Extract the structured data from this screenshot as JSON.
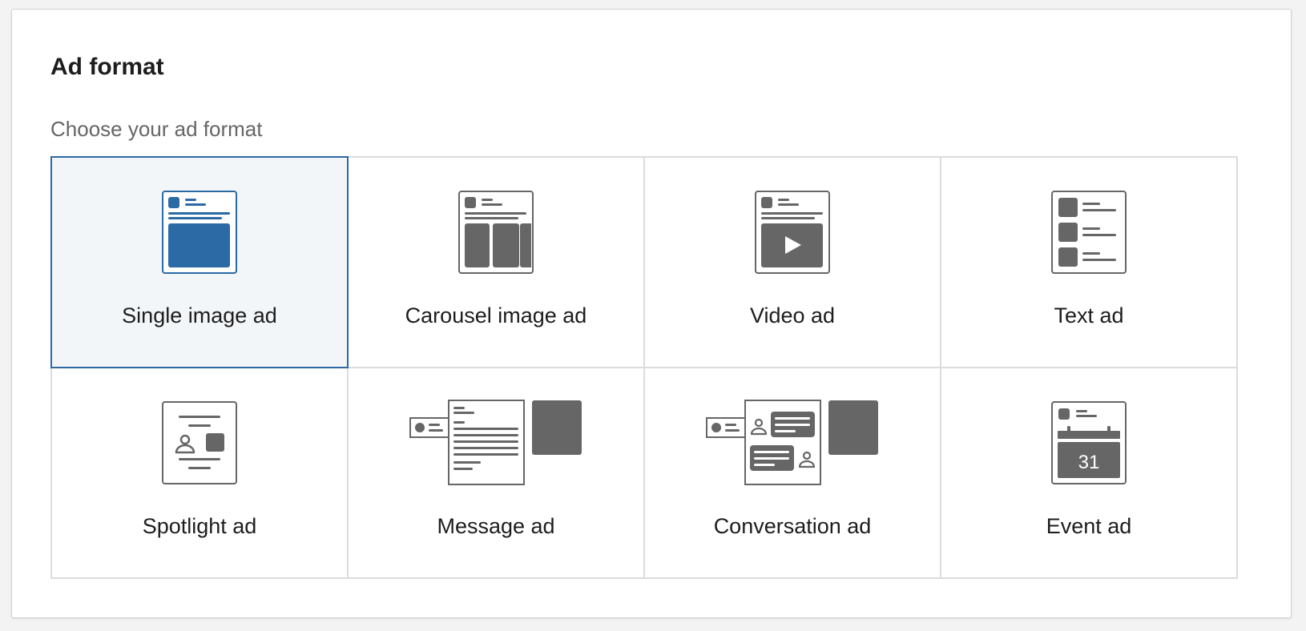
{
  "panel": {
    "title": "Ad format",
    "subtitle": "Choose your ad format"
  },
  "colors": {
    "selected_accent": "#2b6aa5",
    "icon_gray": "#666666",
    "selected_bg": "#f3f6f8",
    "border": "#dcdcdc"
  },
  "formats": [
    {
      "label": "Single image ad",
      "icon": "single-image-ad-icon",
      "selected": true
    },
    {
      "label": "Carousel image ad",
      "icon": "carousel-image-ad-icon",
      "selected": false
    },
    {
      "label": "Video ad",
      "icon": "video-ad-icon",
      "selected": false
    },
    {
      "label": "Text ad",
      "icon": "text-ad-icon",
      "selected": false
    },
    {
      "label": "Spotlight ad",
      "icon": "spotlight-ad-icon",
      "selected": false
    },
    {
      "label": "Message ad",
      "icon": "message-ad-icon",
      "selected": false
    },
    {
      "label": "Conversation ad",
      "icon": "conversation-ad-icon",
      "selected": false
    },
    {
      "label": "Event ad",
      "icon": "event-ad-icon",
      "selected": false,
      "calendar_day": "31"
    }
  ]
}
